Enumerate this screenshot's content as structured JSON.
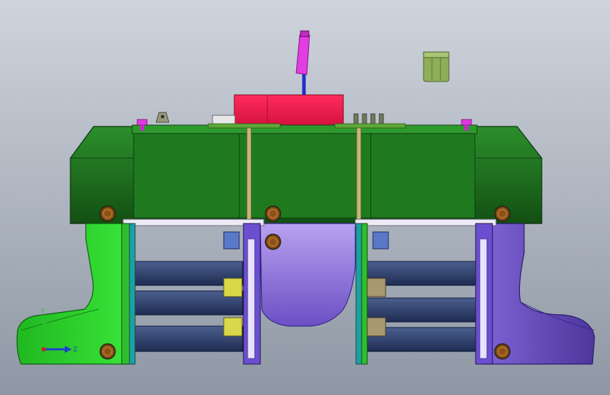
{
  "viewport": {
    "background_top": "#c9cfd8",
    "background_bottom": "#8f98a5"
  },
  "triad": {
    "y_label": "Y",
    "z_label": "Z",
    "y_axis_color": "#2fbf2f",
    "z_axis_color": "#1f3fd0",
    "x_axis_color": "#d02020"
  },
  "colors": {
    "upper_housing": "#1e7a1e",
    "upper_housing_light": "#2e9a2e",
    "left_lower_body": "#2ecf2e",
    "right_lower_body": "#6a4fc0",
    "center_lower_body": "#9b7ee0",
    "red_block": "#ee1c4f",
    "magenta_pin": "#e03ae0",
    "blue_rod": "#2030c0",
    "bushing": "#8fae5a",
    "rail": "#2a3e6e",
    "bolt": "#d08a3a"
  },
  "parts": [
    "magenta-ejector-pin",
    "cylindrical-bushing",
    "red-center-block",
    "upper-green-housing",
    "left-green-lower-body",
    "right-purple-lower-body",
    "center-purple-lower-body",
    "horizontal-slide-rails",
    "vertical-guide-plates",
    "mounting-bolts"
  ]
}
